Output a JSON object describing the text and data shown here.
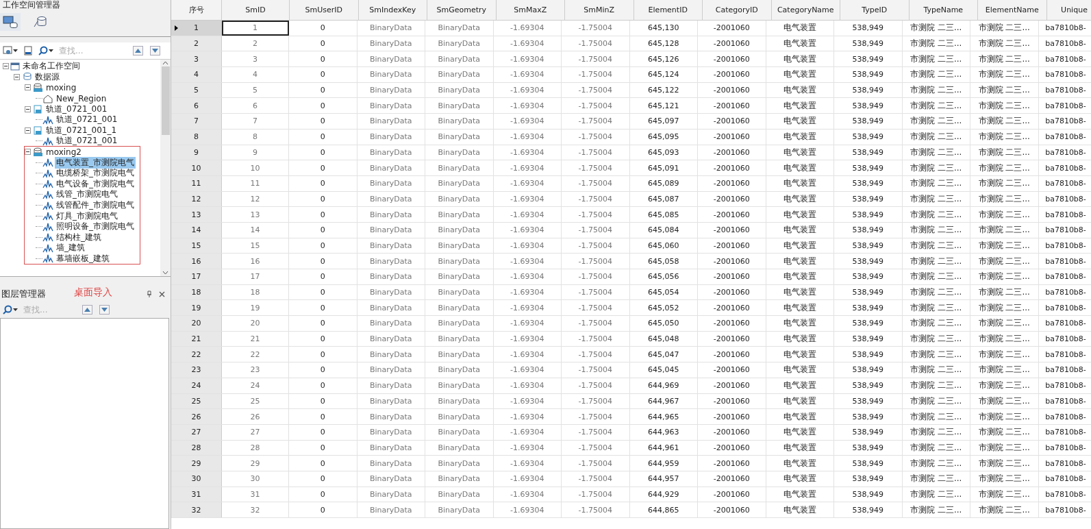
{
  "workspace_panel": {
    "title": "工作空间管理器",
    "tabs": [
      {
        "kind": "workspace",
        "selected": true
      },
      {
        "kind": "datasource",
        "selected": false
      }
    ],
    "search": {
      "placeholder": "查找..."
    },
    "tree": [
      {
        "label": "未命名工作空间",
        "kind": "workspace",
        "expanded": true,
        "selected": false,
        "children": [
          {
            "label": "数据源",
            "kind": "datasources",
            "expanded": true,
            "selected": false,
            "children": [
              {
                "label": "moxing",
                "kind": "udx",
                "expanded": true,
                "selected": false,
                "children": [
                  {
                    "label": "New_Region",
                    "kind": "region",
                    "selected": false
                  }
                ]
              },
              {
                "label": "轨道_0721_001",
                "kind": "udb",
                "expanded": true,
                "selected": false,
                "children": [
                  {
                    "label": "轨道_0721_001",
                    "kind": "model",
                    "selected": false
                  }
                ]
              },
              {
                "label": "轨道_0721_001_1",
                "kind": "udb",
                "expanded": true,
                "selected": false,
                "children": [
                  {
                    "label": "轨道_0721_001",
                    "kind": "model",
                    "selected": false
                  }
                ]
              },
              {
                "label": "moxing2",
                "kind": "udx",
                "expanded": true,
                "selected": false,
                "highlighted": true,
                "children": [
                  {
                    "label": "电气装置_市测院电气",
                    "kind": "model",
                    "selected": true,
                    "highlighted": false
                  },
                  {
                    "label": "电缆桥架_市测院电气",
                    "kind": "model",
                    "selected": false,
                    "highlighted": false
                  },
                  {
                    "label": "电气设备_市测院电气",
                    "kind": "model",
                    "selected": false,
                    "highlighted": false
                  },
                  {
                    "label": "线管_市测院电气",
                    "kind": "model",
                    "selected": false,
                    "highlighted": false
                  },
                  {
                    "label": "线管配件_市测院电气",
                    "kind": "model",
                    "selected": false,
                    "highlighted": false
                  },
                  {
                    "label": "灯具_市测院电气",
                    "kind": "model",
                    "selected": false,
                    "highlighted": false
                  },
                  {
                    "label": "照明设备_市测院电气",
                    "kind": "model",
                    "selected": false,
                    "highlighted": false
                  },
                  {
                    "label": "结构柱_建筑",
                    "kind": "model",
                    "selected": false,
                    "highlighted": false
                  },
                  {
                    "label": "墙_建筑",
                    "kind": "model",
                    "selected": false,
                    "highlighted": false
                  },
                  {
                    "label": "幕墙嵌板_建筑",
                    "kind": "model",
                    "selected": false,
                    "highlighted": false
                  }
                ]
              }
            ]
          }
        ]
      }
    ]
  },
  "layer_panel": {
    "title": "图层管理器",
    "annotation": "桌面导入",
    "search": {
      "placeholder": "查找..."
    }
  },
  "table": {
    "index_header": "序号",
    "columns": [
      "SmID",
      "SmUserID",
      "SmIndexKey",
      "SmGeometry",
      "SmMaxZ",
      "SmMinZ",
      "ElementID",
      "CategoryID",
      "CategoryName",
      "TypeID",
      "TypeName",
      "ElementName",
      "Unique"
    ],
    "rows": [
      {
        "index": "1",
        "selected": true,
        "cells": [
          "1",
          "0",
          "BinaryData",
          "BinaryData",
          "-1.69304",
          "-1.75004",
          "645,130",
          "-2001060",
          "电气装置",
          "538,949",
          "市测院 二三...",
          "市测院 二三...",
          "ba7810b8-"
        ]
      },
      {
        "index": "2",
        "selected": false,
        "cells": [
          "2",
          "0",
          "BinaryData",
          "BinaryData",
          "-1.69304",
          "-1.75004",
          "645,128",
          "-2001060",
          "电气装置",
          "538,949",
          "市测院 二三...",
          "市测院 二三...",
          "ba7810b8-"
        ]
      },
      {
        "index": "3",
        "selected": false,
        "cells": [
          "3",
          "0",
          "BinaryData",
          "BinaryData",
          "-1.69304",
          "-1.75004",
          "645,126",
          "-2001060",
          "电气装置",
          "538,949",
          "市测院 二三...",
          "市测院 二三...",
          "ba7810b8-"
        ]
      },
      {
        "index": "4",
        "selected": false,
        "cells": [
          "4",
          "0",
          "BinaryData",
          "BinaryData",
          "-1.69304",
          "-1.75004",
          "645,124",
          "-2001060",
          "电气装置",
          "538,949",
          "市测院 二三...",
          "市测院 二三...",
          "ba7810b8-"
        ]
      },
      {
        "index": "5",
        "selected": false,
        "cells": [
          "5",
          "0",
          "BinaryData",
          "BinaryData",
          "-1.69304",
          "-1.75004",
          "645,122",
          "-2001060",
          "电气装置",
          "538,949",
          "市测院 二三...",
          "市测院 二三...",
          "ba7810b8-"
        ]
      },
      {
        "index": "6",
        "selected": false,
        "cells": [
          "6",
          "0",
          "BinaryData",
          "BinaryData",
          "-1.69304",
          "-1.75004",
          "645,121",
          "-2001060",
          "电气装置",
          "538,949",
          "市测院 二三...",
          "市测院 二三...",
          "ba7810b8-"
        ]
      },
      {
        "index": "7",
        "selected": false,
        "cells": [
          "7",
          "0",
          "BinaryData",
          "BinaryData",
          "-1.69304",
          "-1.75004",
          "645,097",
          "-2001060",
          "电气装置",
          "538,949",
          "市测院 二三...",
          "市测院 二三...",
          "ba7810b8-"
        ]
      },
      {
        "index": "8",
        "selected": false,
        "cells": [
          "8",
          "0",
          "BinaryData",
          "BinaryData",
          "-1.69304",
          "-1.75004",
          "645,095",
          "-2001060",
          "电气装置",
          "538,949",
          "市测院 二三...",
          "市测院 二三...",
          "ba7810b8-"
        ]
      },
      {
        "index": "9",
        "selected": false,
        "cells": [
          "9",
          "0",
          "BinaryData",
          "BinaryData",
          "-1.69304",
          "-1.75004",
          "645,093",
          "-2001060",
          "电气装置",
          "538,949",
          "市测院 二三...",
          "市测院 二三...",
          "ba7810b8-"
        ]
      },
      {
        "index": "10",
        "selected": false,
        "cells": [
          "10",
          "0",
          "BinaryData",
          "BinaryData",
          "-1.69304",
          "-1.75004",
          "645,091",
          "-2001060",
          "电气装置",
          "538,949",
          "市测院 二三...",
          "市测院 二三...",
          "ba7810b8-"
        ]
      },
      {
        "index": "11",
        "selected": false,
        "cells": [
          "11",
          "0",
          "BinaryData",
          "BinaryData",
          "-1.69304",
          "-1.75004",
          "645,089",
          "-2001060",
          "电气装置",
          "538,949",
          "市测院 二三...",
          "市测院 二三...",
          "ba7810b8-"
        ]
      },
      {
        "index": "12",
        "selected": false,
        "cells": [
          "12",
          "0",
          "BinaryData",
          "BinaryData",
          "-1.69304",
          "-1.75004",
          "645,087",
          "-2001060",
          "电气装置",
          "538,949",
          "市测院 二三...",
          "市测院 二三...",
          "ba7810b8-"
        ]
      },
      {
        "index": "13",
        "selected": false,
        "cells": [
          "13",
          "0",
          "BinaryData",
          "BinaryData",
          "-1.69304",
          "-1.75004",
          "645,085",
          "-2001060",
          "电气装置",
          "538,949",
          "市测院 二三...",
          "市测院 二三...",
          "ba7810b8-"
        ]
      },
      {
        "index": "14",
        "selected": false,
        "cells": [
          "14",
          "0",
          "BinaryData",
          "BinaryData",
          "-1.69304",
          "-1.75004",
          "645,084",
          "-2001060",
          "电气装置",
          "538,949",
          "市测院 二三...",
          "市测院 二三...",
          "ba7810b8-"
        ]
      },
      {
        "index": "15",
        "selected": false,
        "cells": [
          "15",
          "0",
          "BinaryData",
          "BinaryData",
          "-1.69304",
          "-1.75004",
          "645,060",
          "-2001060",
          "电气装置",
          "538,949",
          "市测院 二三...",
          "市测院 二三...",
          "ba7810b8-"
        ]
      },
      {
        "index": "16",
        "selected": false,
        "cells": [
          "16",
          "0",
          "BinaryData",
          "BinaryData",
          "-1.69304",
          "-1.75004",
          "645,058",
          "-2001060",
          "电气装置",
          "538,949",
          "市测院 二三...",
          "市测院 二三...",
          "ba7810b8-"
        ]
      },
      {
        "index": "17",
        "selected": false,
        "cells": [
          "17",
          "0",
          "BinaryData",
          "BinaryData",
          "-1.69304",
          "-1.75004",
          "645,056",
          "-2001060",
          "电气装置",
          "538,949",
          "市测院 二三...",
          "市测院 二三...",
          "ba7810b8-"
        ]
      },
      {
        "index": "18",
        "selected": false,
        "cells": [
          "18",
          "0",
          "BinaryData",
          "BinaryData",
          "-1.69304",
          "-1.75004",
          "645,054",
          "-2001060",
          "电气装置",
          "538,949",
          "市测院 二三...",
          "市测院 二三...",
          "ba7810b8-"
        ]
      },
      {
        "index": "19",
        "selected": false,
        "cells": [
          "19",
          "0",
          "BinaryData",
          "BinaryData",
          "-1.69304",
          "-1.75004",
          "645,052",
          "-2001060",
          "电气装置",
          "538,949",
          "市测院 二三...",
          "市测院 二三...",
          "ba7810b8-"
        ]
      },
      {
        "index": "20",
        "selected": false,
        "cells": [
          "20",
          "0",
          "BinaryData",
          "BinaryData",
          "-1.69304",
          "-1.75004",
          "645,050",
          "-2001060",
          "电气装置",
          "538,949",
          "市测院 二三...",
          "市测院 二三...",
          "ba7810b8-"
        ]
      },
      {
        "index": "21",
        "selected": false,
        "cells": [
          "21",
          "0",
          "BinaryData",
          "BinaryData",
          "-1.69304",
          "-1.75004",
          "645,048",
          "-2001060",
          "电气装置",
          "538,949",
          "市测院 二三...",
          "市测院 二三...",
          "ba7810b8-"
        ]
      },
      {
        "index": "22",
        "selected": false,
        "cells": [
          "22",
          "0",
          "BinaryData",
          "BinaryData",
          "-1.69304",
          "-1.75004",
          "645,047",
          "-2001060",
          "电气装置",
          "538,949",
          "市测院 二三...",
          "市测院 二三...",
          "ba7810b8-"
        ]
      },
      {
        "index": "23",
        "selected": false,
        "cells": [
          "23",
          "0",
          "BinaryData",
          "BinaryData",
          "-1.69304",
          "-1.75004",
          "645,045",
          "-2001060",
          "电气装置",
          "538,949",
          "市测院 二三...",
          "市测院 二三...",
          "ba7810b8-"
        ]
      },
      {
        "index": "24",
        "selected": false,
        "cells": [
          "24",
          "0",
          "BinaryData",
          "BinaryData",
          "-1.69304",
          "-1.75004",
          "644,969",
          "-2001060",
          "电气装置",
          "538,949",
          "市测院 二三...",
          "市测院 二三...",
          "ba7810b8-"
        ]
      },
      {
        "index": "25",
        "selected": false,
        "cells": [
          "25",
          "0",
          "BinaryData",
          "BinaryData",
          "-1.69304",
          "-1.75004",
          "644,967",
          "-2001060",
          "电气装置",
          "538,949",
          "市测院 二三...",
          "市测院 二三...",
          "ba7810b8-"
        ]
      },
      {
        "index": "26",
        "selected": false,
        "cells": [
          "26",
          "0",
          "BinaryData",
          "BinaryData",
          "-1.69304",
          "-1.75004",
          "644,965",
          "-2001060",
          "电气装置",
          "538,949",
          "市测院 二三...",
          "市测院 二三...",
          "ba7810b8-"
        ]
      },
      {
        "index": "27",
        "selected": false,
        "cells": [
          "27",
          "0",
          "BinaryData",
          "BinaryData",
          "-1.69304",
          "-1.75004",
          "644,963",
          "-2001060",
          "电气装置",
          "538,949",
          "市测院 二三...",
          "市测院 二三...",
          "ba7810b8-"
        ]
      },
      {
        "index": "28",
        "selected": false,
        "cells": [
          "28",
          "0",
          "BinaryData",
          "BinaryData",
          "-1.69304",
          "-1.75004",
          "644,961",
          "-2001060",
          "电气装置",
          "538,949",
          "市测院 二三...",
          "市测院 二三...",
          "ba7810b8-"
        ]
      },
      {
        "index": "29",
        "selected": false,
        "cells": [
          "29",
          "0",
          "BinaryData",
          "BinaryData",
          "-1.69304",
          "-1.75004",
          "644,959",
          "-2001060",
          "电气装置",
          "538,949",
          "市测院 二三...",
          "市测院 二三...",
          "ba7810b8-"
        ]
      },
      {
        "index": "30",
        "selected": false,
        "cells": [
          "30",
          "0",
          "BinaryData",
          "BinaryData",
          "-1.69304",
          "-1.75004",
          "644,957",
          "-2001060",
          "电气装置",
          "538,949",
          "市测院 二三...",
          "市测院 二三...",
          "ba7810b8-"
        ]
      },
      {
        "index": "31",
        "selected": false,
        "cells": [
          "31",
          "0",
          "BinaryData",
          "BinaryData",
          "-1.69304",
          "-1.75004",
          "644,929",
          "-2001060",
          "电气装置",
          "538,949",
          "市测院 二三...",
          "市测院 二三...",
          "ba7810b8-"
        ]
      },
      {
        "index": "32",
        "selected": false,
        "cells": [
          "32",
          "0",
          "BinaryData",
          "BinaryData",
          "-1.69304",
          "-1.75004",
          "644,865",
          "-2001060",
          "电气装置",
          "538,949",
          "市测院 二三...",
          "市测院 二三...",
          "ba7810b8-"
        ]
      }
    ]
  }
}
